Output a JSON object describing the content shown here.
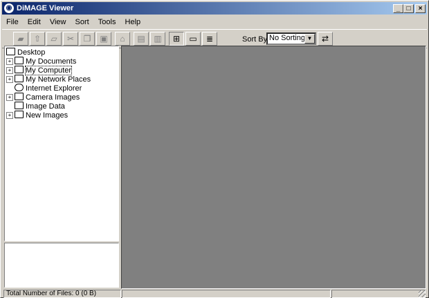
{
  "window": {
    "title": "DiMAGE Viewer",
    "minimize": "_",
    "maximize": "□",
    "close": "×"
  },
  "menu": [
    {
      "label": "File"
    },
    {
      "label": "Edit"
    },
    {
      "label": "View"
    },
    {
      "label": "Sort"
    },
    {
      "label": "Tools"
    },
    {
      "label": "Help"
    }
  ],
  "toolbar": {
    "sort_label": "Sort By :",
    "sort_value": "No Sorting",
    "buttons": [
      {
        "icon": "open-folder-icon"
      },
      {
        "icon": "folder-up-icon"
      },
      {
        "icon": "new-folder-icon"
      },
      {
        "icon": "cut-icon"
      },
      {
        "icon": "copy-icon"
      },
      {
        "icon": "paste-icon"
      },
      {
        "icon": "rotate-icon"
      },
      {
        "icon": "print-icon"
      },
      {
        "icon": "slideshow-icon"
      },
      {
        "icon": "large-thumbnails-icon"
      },
      {
        "icon": "small-thumbnails-icon"
      },
      {
        "icon": "details-icon"
      },
      {
        "icon": "sort-order-icon"
      }
    ]
  },
  "tree": [
    {
      "label": "Desktop",
      "icon": "desktop-icon",
      "expand": ""
    },
    {
      "label": "My Documents",
      "icon": "my-documents-icon",
      "expand": "+"
    },
    {
      "label": "My Computer",
      "icon": "my-computer-icon",
      "expand": "+"
    },
    {
      "label": "My Network Places",
      "icon": "network-places-icon",
      "expand": "+"
    },
    {
      "label": "Internet Explorer",
      "icon": "internet-explorer-icon",
      "expand": ""
    },
    {
      "label": "Camera Images",
      "icon": "folder-icon",
      "expand": "+"
    },
    {
      "label": "Image Data",
      "icon": "folder-icon",
      "expand": ""
    },
    {
      "label": "New Images",
      "icon": "folder-icon",
      "expand": "+"
    }
  ],
  "status": {
    "files": "Total Number of Files: 0 (0 B)"
  }
}
